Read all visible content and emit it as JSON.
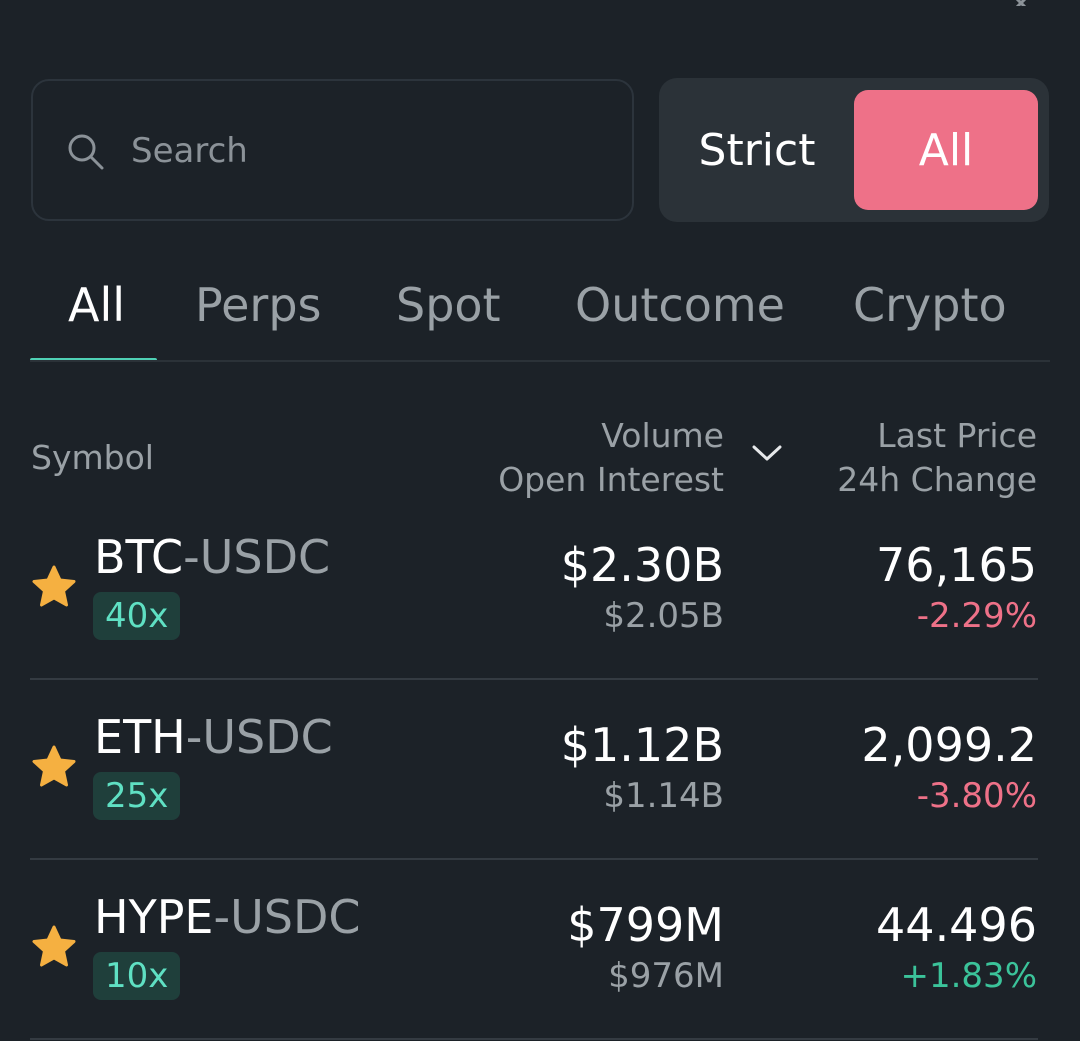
{
  "search": {
    "placeholder": "Search",
    "value": ""
  },
  "toggle": {
    "strict_label": "Strict",
    "all_label": "All",
    "selected": "All"
  },
  "tabs": [
    {
      "label": "All",
      "active": true
    },
    {
      "label": "Perps",
      "active": false
    },
    {
      "label": "Spot",
      "active": false
    },
    {
      "label": "Outcome",
      "active": false
    },
    {
      "label": "Crypto",
      "active": false
    }
  ],
  "columns": {
    "symbol": "Symbol",
    "volume": "Volume",
    "open_interest": "Open Interest",
    "last_price": "Last Price",
    "change_24h": "24h Change"
  },
  "rows": [
    {
      "base": "BTC",
      "quote": "USDC",
      "leverage": "40x",
      "volume": "$2.30B",
      "open_interest": "$2.05B",
      "last_price": "76,165",
      "change": "-2.29%",
      "change_dir": "neg",
      "favorite": true
    },
    {
      "base": "ETH",
      "quote": "USDC",
      "leverage": "25x",
      "volume": "$1.12B",
      "open_interest": "$1.14B",
      "last_price": "2,099.2",
      "change": "-3.80%",
      "change_dir": "neg",
      "favorite": true
    },
    {
      "base": "HYPE",
      "quote": "USDC",
      "leverage": "10x",
      "volume": "$799M",
      "open_interest": "$976M",
      "last_price": "44.496",
      "change": "+1.83%",
      "change_dir": "pos",
      "favorite": true
    }
  ],
  "colors": {
    "background": "#1c2228",
    "accent_pink": "#ee7188",
    "accent_teal": "#4fd1b5",
    "negative": "#ee7188",
    "positive": "#3bc39a",
    "star": "#f5b041"
  },
  "icons": {
    "search": "search-icon",
    "sort": "chevron-down-icon",
    "favorite": "star-icon",
    "close": "close-icon"
  }
}
